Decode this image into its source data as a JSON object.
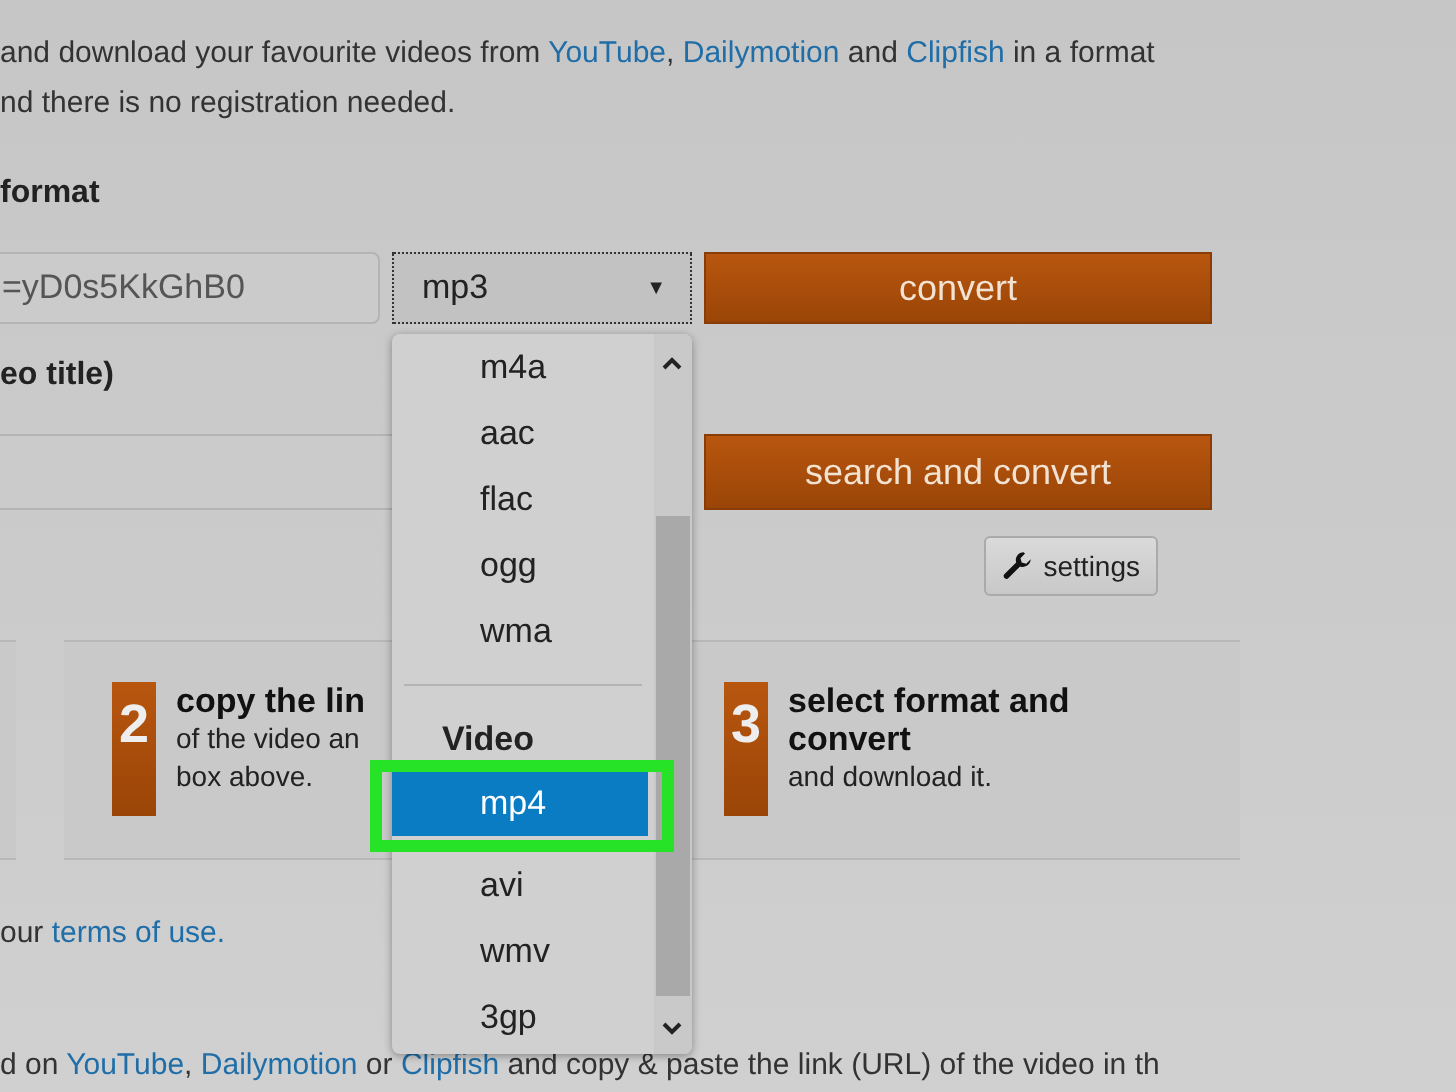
{
  "intro_lines": [
    [
      {
        "kind": "text",
        "text": "and download your favourite videos from "
      },
      {
        "kind": "link",
        "text": "YouTube"
      },
      {
        "kind": "text",
        "text": ", "
      },
      {
        "kind": "link",
        "text": "Dailymotion"
      },
      {
        "kind": "text",
        "text": " and "
      },
      {
        "kind": "link",
        "text": "Clipfish"
      },
      {
        "kind": "text",
        "text": " in a format"
      }
    ],
    [
      {
        "kind": "text",
        "text": "nd there is no registration needed."
      }
    ]
  ],
  "url_section": {
    "heading": "format",
    "url_value": "=yD0s5KkGhB0",
    "format_select": "mp3",
    "caret": "▼",
    "convert_button": "convert"
  },
  "search_section": {
    "heading": "eo title)",
    "search_button": "search and convert",
    "settings_button": "settings"
  },
  "steps": [
    {
      "number": "2",
      "title": "copy the lin",
      "lines": [
        "of the video an",
        "box above."
      ]
    },
    {
      "number": "3",
      "title": "select format and convert",
      "lines": [
        "and download it."
      ]
    }
  ],
  "terms_line": [
    {
      "kind": "text",
      "text": "our "
    },
    {
      "kind": "link",
      "text": "terms of use."
    }
  ],
  "bottom_line": [
    {
      "kind": "text",
      "text": "d on "
    },
    {
      "kind": "link",
      "text": "YouTube"
    },
    {
      "kind": "text",
      "text": ", "
    },
    {
      "kind": "link",
      "text": "Dailymotion"
    },
    {
      "kind": "text",
      "text": " or "
    },
    {
      "kind": "link",
      "text": "Clipfish"
    },
    {
      "kind": "text",
      "text": " and copy & paste the link (URL) of the video in th"
    }
  ],
  "format_dropdown": {
    "items": [
      {
        "kind": "option",
        "label": "m4a",
        "selected": false
      },
      {
        "kind": "option",
        "label": "aac",
        "selected": false
      },
      {
        "kind": "option",
        "label": "flac",
        "selected": false
      },
      {
        "kind": "option",
        "label": "ogg",
        "selected": false
      },
      {
        "kind": "option",
        "label": "wma",
        "selected": false
      },
      {
        "kind": "divider"
      },
      {
        "kind": "group",
        "label": "Video"
      },
      {
        "kind": "option",
        "label": "mp4",
        "selected": true,
        "highlighted": true
      },
      {
        "kind": "option",
        "label": "avi",
        "selected": false
      },
      {
        "kind": "option",
        "label": "wmv",
        "selected": false
      },
      {
        "kind": "option",
        "label": "3gp",
        "selected": false
      }
    ]
  }
}
